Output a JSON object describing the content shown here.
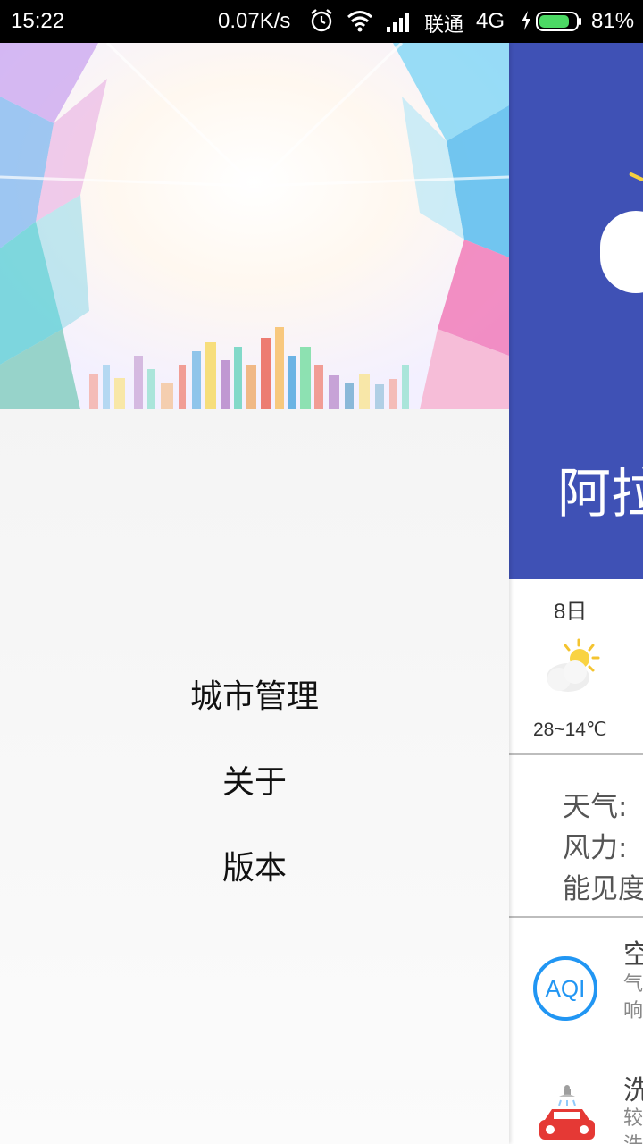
{
  "status_bar": {
    "time": "15:22",
    "speed": "0.07K/s",
    "carrier": "联通",
    "network": "4G",
    "battery": "81%",
    "icons": [
      "alarm-icon",
      "wifi-icon",
      "signal-icon",
      "charging-icon",
      "battery-icon"
    ]
  },
  "drawer": {
    "header_image": "city-skyline-banner",
    "menu": [
      {
        "label": "城市管理"
      },
      {
        "label": "关于"
      },
      {
        "label": "版本"
      }
    ]
  },
  "background_app": {
    "city_name_visible": "阿拉",
    "forecast": {
      "day": "8日",
      "temp": "28~14℃",
      "icon": "partly-sunny-icon"
    },
    "details": [
      "天气:",
      "风力:",
      "能见度"
    ],
    "life_index": [
      {
        "title": "空",
        "sub": [
          "气",
          "响"
        ],
        "icon": "aqi-icon",
        "icon_text": "AQI"
      },
      {
        "title": "洗",
        "sub": [
          "较",
          "洗"
        ],
        "icon": "car-wash-icon"
      }
    ]
  },
  "colors": {
    "header_blue": "#3F51B5",
    "aqi_blue": "#2196F3",
    "battery_green": "#4CD964",
    "car_red": "#E53935"
  }
}
